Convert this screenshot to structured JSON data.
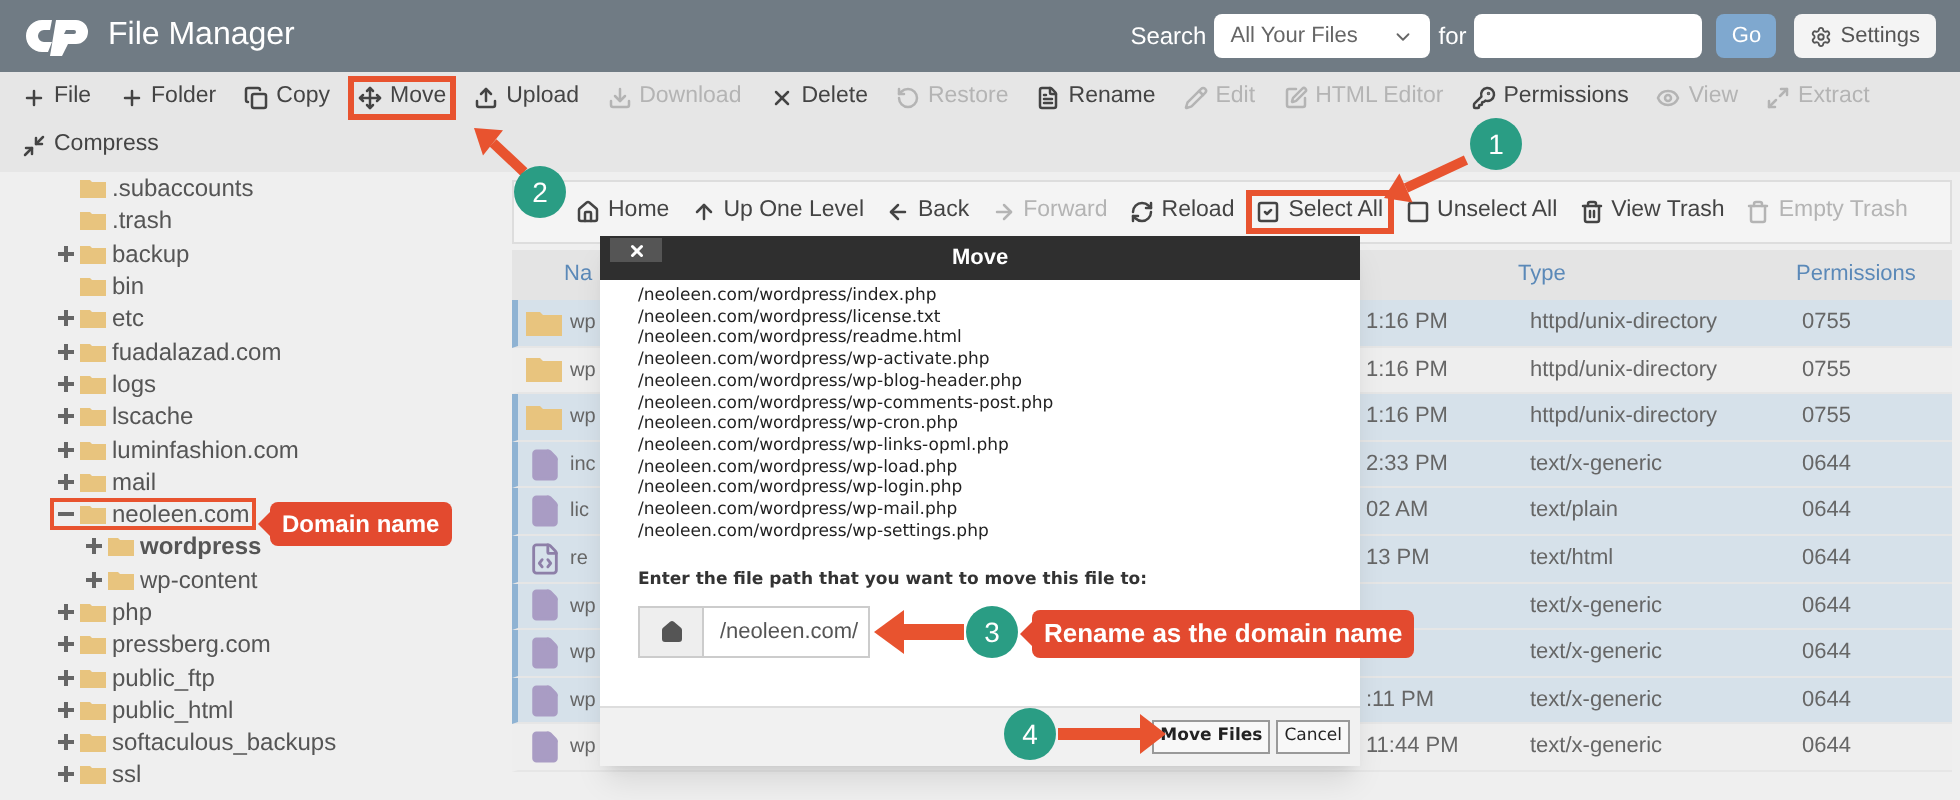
{
  "header": {
    "title": "File Manager",
    "search_label": "Search",
    "scope": "All Your Files",
    "for_label": "for",
    "go": "Go",
    "settings": "Settings"
  },
  "toolbar": [
    {
      "label": "File",
      "disabled": false,
      "highlighted": false
    },
    {
      "label": "Folder",
      "disabled": false,
      "highlighted": false
    },
    {
      "label": "Copy",
      "disabled": false,
      "highlighted": false
    },
    {
      "label": "Move",
      "disabled": false,
      "highlighted": true
    },
    {
      "label": "Upload",
      "disabled": false,
      "highlighted": false
    },
    {
      "label": "Download",
      "disabled": true,
      "highlighted": false
    },
    {
      "label": "Delete",
      "disabled": false,
      "highlighted": false
    },
    {
      "label": "Restore",
      "disabled": true,
      "highlighted": false
    },
    {
      "label": "Rename",
      "disabled": false,
      "highlighted": false
    },
    {
      "label": "Edit",
      "disabled": true,
      "highlighted": false
    },
    {
      "label": "HTML Editor",
      "disabled": true,
      "highlighted": false
    },
    {
      "label": "Permissions",
      "disabled": false,
      "highlighted": false
    },
    {
      "label": "View",
      "disabled": true,
      "highlighted": false
    },
    {
      "label": "Extract",
      "disabled": true,
      "highlighted": false
    },
    {
      "label": "Compress",
      "disabled": false,
      "highlighted": false
    }
  ],
  "tree": [
    {
      "label": ".subaccounts",
      "selected": false,
      "highlighted": false
    },
    {
      "label": ".trash",
      "selected": false,
      "highlighted": false
    },
    {
      "label": "backup",
      "expanded": false,
      "selected": false,
      "highlighted": false
    },
    {
      "label": "bin",
      "selected": false,
      "highlighted": false
    },
    {
      "label": "etc",
      "expanded": false,
      "selected": false,
      "highlighted": false
    },
    {
      "label": "fuadalazad.com",
      "expanded": false,
      "selected": false,
      "highlighted": false
    },
    {
      "label": "logs",
      "expanded": false,
      "selected": false,
      "highlighted": false
    },
    {
      "label": "lscache",
      "expanded": false,
      "selected": false,
      "highlighted": false
    },
    {
      "label": "luminfashion.com",
      "expanded": false,
      "selected": false,
      "highlighted": false
    },
    {
      "label": "mail",
      "expanded": false,
      "selected": false,
      "highlighted": false
    },
    {
      "label": "neoleen.com",
      "expanded": true,
      "selected": false,
      "highlighted": true,
      "children": [
        {
          "label": "wordpress",
          "expanded": false,
          "selected": true,
          "highlighted": false
        },
        {
          "label": "wp-content",
          "expanded": false,
          "selected": false,
          "highlighted": false
        }
      ]
    },
    {
      "label": "php",
      "expanded": false,
      "selected": false,
      "highlighted": false
    },
    {
      "label": "pressberg.com",
      "expanded": false,
      "selected": false,
      "highlighted": false
    },
    {
      "label": "public_ftp",
      "expanded": false,
      "selected": false,
      "highlighted": false
    },
    {
      "label": "public_html",
      "expanded": false,
      "selected": false,
      "highlighted": false
    },
    {
      "label": "softaculous_backups",
      "expanded": false,
      "selected": false,
      "highlighted": false
    },
    {
      "label": "ssl",
      "expanded": false,
      "selected": false,
      "highlighted": false
    }
  ],
  "nav": [
    {
      "label": "Home",
      "disabled": false,
      "highlighted": false
    },
    {
      "label": "Up One Level",
      "disabled": false,
      "highlighted": false
    },
    {
      "label": "Back",
      "disabled": false,
      "highlighted": false
    },
    {
      "label": "Forward",
      "disabled": true,
      "highlighted": false
    },
    {
      "label": "Reload",
      "disabled": false,
      "highlighted": false
    },
    {
      "label": "Select All",
      "disabled": false,
      "highlighted": true
    },
    {
      "label": "Unselect All",
      "disabled": false,
      "highlighted": false
    },
    {
      "label": "View Trash",
      "disabled": false,
      "highlighted": false
    },
    {
      "label": "Empty Trash",
      "disabled": true,
      "highlighted": false
    }
  ],
  "table": {
    "columns": [
      "Na",
      "Type",
      "Permissions"
    ],
    "rows": [
      {
        "kind": "folder",
        "name": "wp",
        "modified": "1:16 PM",
        "type": "httpd/unix-directory",
        "permissions": "0755",
        "selected": true
      },
      {
        "kind": "folder",
        "name": "wp",
        "modified": "1:16 PM",
        "type": "httpd/unix-directory",
        "permissions": "0755",
        "selected": false
      },
      {
        "kind": "folder",
        "name": "wp",
        "modified": "1:16 PM",
        "type": "httpd/unix-directory",
        "permissions": "0755",
        "selected": true
      },
      {
        "kind": "file",
        "name": "inc",
        "modified": "2:33 PM",
        "type": "text/x-generic",
        "permissions": "0644",
        "selected": true
      },
      {
        "kind": "file",
        "name": "lic",
        "modified": "02 AM",
        "type": "text/plain",
        "permissions": "0644",
        "selected": true
      },
      {
        "kind": "code",
        "name": "re",
        "modified": "13 PM",
        "type": "text/html",
        "permissions": "0644",
        "selected": true
      },
      {
        "kind": "file",
        "name": "wp",
        "type": "text/x-generic",
        "permissions": "0644",
        "selected": true
      },
      {
        "kind": "file",
        "name": "wp",
        "type": "text/x-generic",
        "permissions": "0644",
        "selected": true
      },
      {
        "kind": "file",
        "name": "wp",
        "modified": ":11 PM",
        "type": "text/x-generic",
        "permissions": "0644",
        "selected": true
      },
      {
        "kind": "file",
        "name": "wp",
        "modified": "11:44 PM",
        "type": "text/x-generic",
        "permissions": "0644",
        "selected": false
      }
    ]
  },
  "dialog": {
    "title": "Move",
    "paths": [
      "/neoleen.com/wordpress/index.php",
      "/neoleen.com/wordpress/license.txt",
      "/neoleen.com/wordpress/readme.html",
      "/neoleen.com/wordpress/wp-activate.php",
      "/neoleen.com/wordpress/wp-blog-header.php",
      "/neoleen.com/wordpress/wp-comments-post.php",
      "/neoleen.com/wordpress/wp-cron.php",
      "/neoleen.com/wordpress/wp-links-opml.php",
      "/neoleen.com/wordpress/wp-load.php",
      "/neoleen.com/wordpress/wp-login.php",
      "/neoleen.com/wordpress/wp-mail.php",
      "/neoleen.com/wordpress/wp-settings.php"
    ],
    "prompt": "Enter the file path that you want to move this file to:",
    "destination": "/neoleen.com/",
    "move_button": "Move Files",
    "cancel_button": "Cancel"
  },
  "annotations": {
    "steps": [
      "1",
      "2",
      "3",
      "4"
    ],
    "domain_note": "Domain name",
    "rename_note": "Rename as the domain name"
  }
}
